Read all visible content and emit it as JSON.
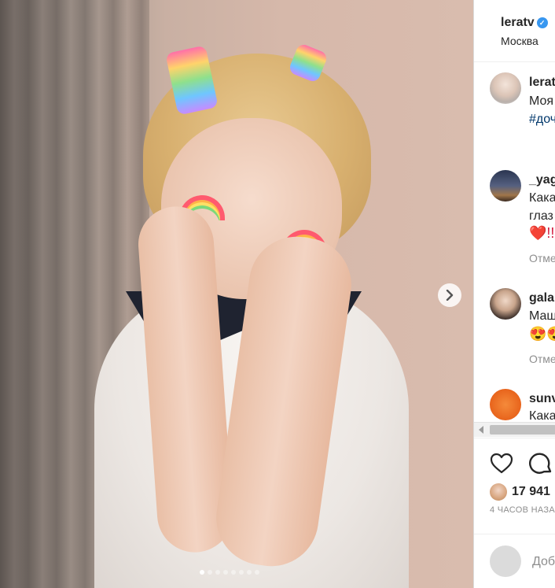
{
  "post": {
    "carousel": {
      "slide_count": 8,
      "active_index": 0
    }
  },
  "header": {
    "username": "leratv",
    "location": "Москва"
  },
  "caption": {
    "username": "lerat",
    "text": "Моя",
    "hashtag": "#доч"
  },
  "comments": [
    {
      "username": "_yag",
      "lines": [
        "Кака",
        "глаз"
      ],
      "emoji": "❤️!!",
      "reply_label": "Отме"
    },
    {
      "username": "gala",
      "lines": [
        "Маш"
      ],
      "emoji": "😍😍",
      "reply_label": "Отме"
    },
    {
      "username": "sunv",
      "lines": [
        "Кака"
      ]
    }
  ],
  "engagement": {
    "likes": "17 941",
    "time_ago": "4 ЧАСОВ НАЗА"
  },
  "composer": {
    "placeholder": "Доб"
  },
  "colors": {
    "link": "#00376b",
    "verified": "#3897f0",
    "muted": "#8e8e8e",
    "divider": "#dbdbdb"
  },
  "icons": {
    "verified": "verified-badge-icon",
    "next": "chevron-right-icon",
    "like": "heart-icon",
    "comment": "comment-bubble-icon",
    "scroll_left": "scroll-left-arrow-icon"
  }
}
